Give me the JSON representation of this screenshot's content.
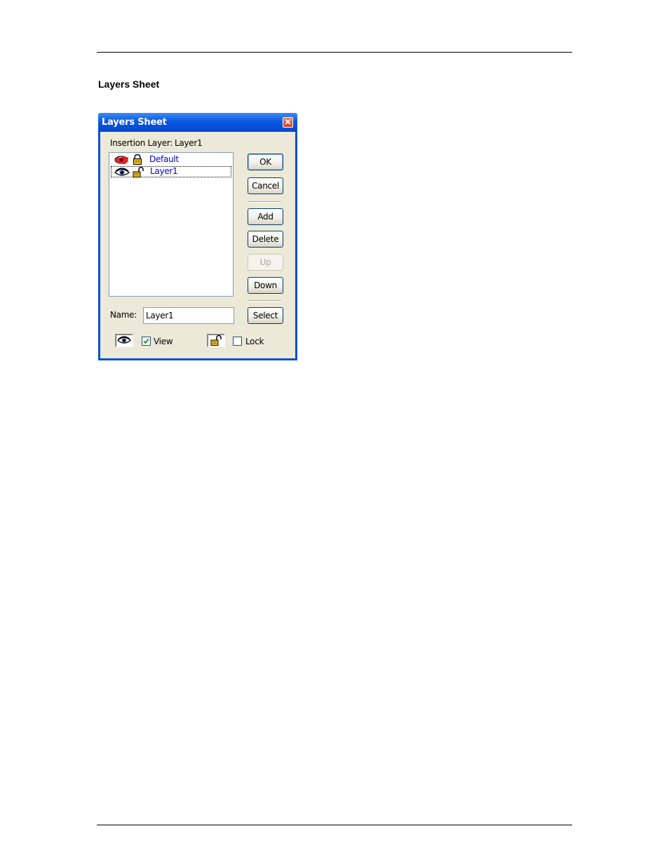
{
  "document": {
    "heading": "Layers Sheet"
  },
  "dialog": {
    "title": "Layers Sheet",
    "insertion_label": "Insertion Layer:",
    "insertion_value": "Layer1",
    "layers": [
      {
        "name": "Default",
        "visible": false,
        "locked": true
      },
      {
        "name": "Layer1",
        "visible": true,
        "locked": false
      }
    ],
    "buttons": {
      "ok": "OK",
      "cancel": "Cancel",
      "add": "Add",
      "delete": "Delete",
      "up": "Up",
      "down": "Down",
      "select": "Select"
    },
    "name_label": "Name:",
    "name_value": "Layer1",
    "view_label": "View",
    "view_checked": true,
    "lock_label": "Lock",
    "lock_checked": false
  },
  "colors": {
    "titlebar": "#0a58e0",
    "dialog_face": "#ece9d8",
    "list_text": "#0000e0"
  }
}
